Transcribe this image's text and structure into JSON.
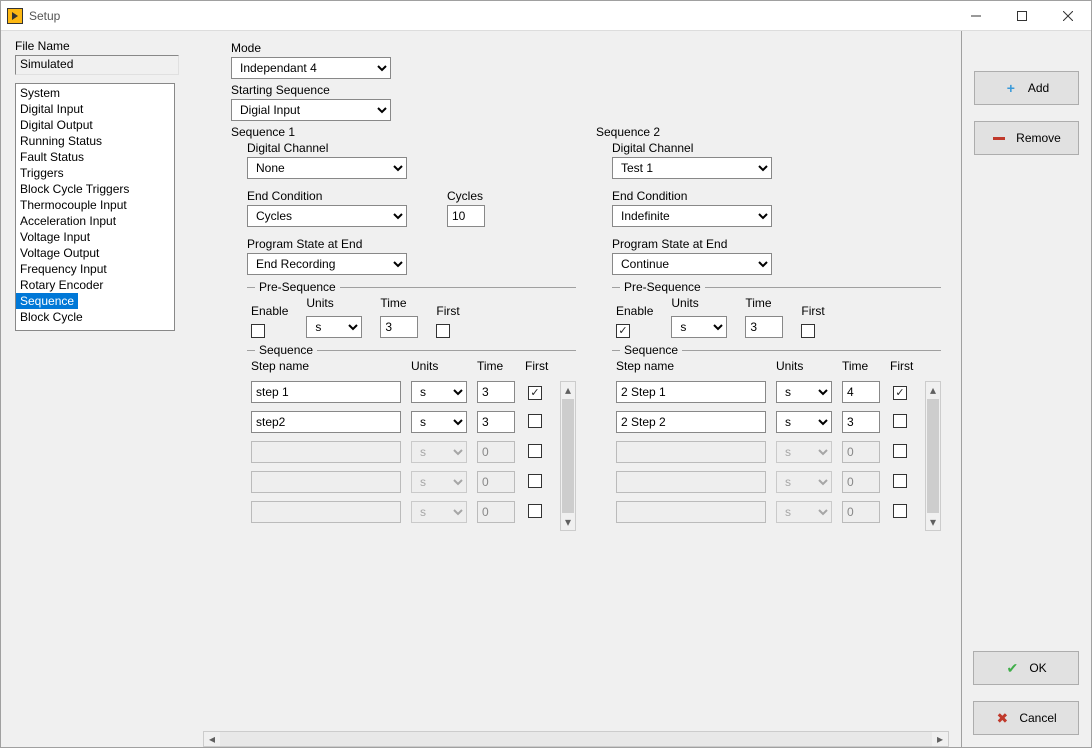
{
  "window": {
    "title": "Setup"
  },
  "file": {
    "label": "File Name",
    "value": "Simulated"
  },
  "nav": {
    "items": [
      "System",
      "Digital Input",
      "Digital Output",
      "Running Status",
      "Fault Status",
      "Triggers",
      "Block Cycle Triggers",
      "Thermocouple Input",
      "Acceleration Input",
      "Voltage Input",
      "Voltage Output",
      "Frequency Input",
      "Rotary Encoder",
      "Sequence",
      "Block Cycle"
    ],
    "selected": "Sequence"
  },
  "mode": {
    "label": "Mode",
    "value": "Independant 4"
  },
  "starting": {
    "label": "Starting Sequence",
    "value": "Digial Input"
  },
  "labels": {
    "digital_channel": "Digital Channel",
    "end_condition": "End Condition",
    "cycles": "Cycles",
    "program_state": "Program State at End",
    "pre_sequence": "Pre-Sequence",
    "sequence": "Sequence",
    "enable": "Enable",
    "units": "Units",
    "time": "Time",
    "first": "First",
    "step_name": "Step name"
  },
  "sequences": [
    {
      "title": "Sequence 1",
      "digital_channel": "None",
      "end_condition": "Cycles",
      "cycles": "10",
      "program_state": "End Recording",
      "pre": {
        "enable": false,
        "units": "s",
        "time": "3",
        "first": false
      },
      "steps": [
        {
          "name": "step 1",
          "units": "s",
          "time": "3",
          "first": true,
          "enabled": true
        },
        {
          "name": "step2",
          "units": "s",
          "time": "3",
          "first": false,
          "enabled": true
        },
        {
          "name": "",
          "units": "s",
          "time": "0",
          "first": false,
          "enabled": false
        },
        {
          "name": "",
          "units": "s",
          "time": "0",
          "first": false,
          "enabled": false
        },
        {
          "name": "",
          "units": "s",
          "time": "0",
          "first": false,
          "enabled": false
        }
      ]
    },
    {
      "title": "Sequence 2",
      "digital_channel": "Test 1",
      "end_condition": "Indefinite",
      "cycles": "",
      "program_state": "Continue",
      "pre": {
        "enable": true,
        "units": "s",
        "time": "3",
        "first": false
      },
      "steps": [
        {
          "name": "2 Step 1",
          "units": "s",
          "time": "4",
          "first": true,
          "enabled": true
        },
        {
          "name": "2 Step 2",
          "units": "s",
          "time": "3",
          "first": false,
          "enabled": true
        },
        {
          "name": "",
          "units": "s",
          "time": "0",
          "first": false,
          "enabled": false
        },
        {
          "name": "",
          "units": "s",
          "time": "0",
          "first": false,
          "enabled": false
        },
        {
          "name": "",
          "units": "s",
          "time": "0",
          "first": false,
          "enabled": false
        }
      ]
    }
  ],
  "buttons": {
    "add": "Add",
    "remove": "Remove",
    "ok": "OK",
    "cancel": "Cancel"
  }
}
